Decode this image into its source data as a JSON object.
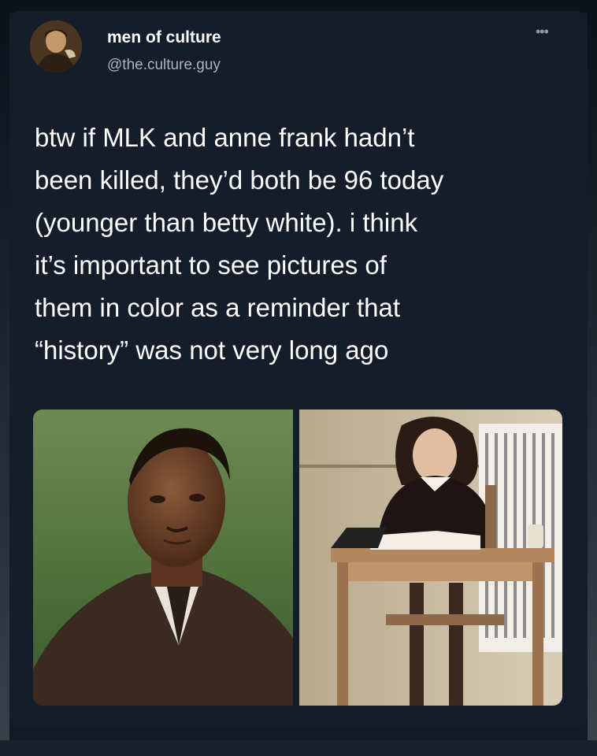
{
  "tweet": {
    "author": {
      "display_name": "men of culture",
      "handle": "@the.culture.guy"
    },
    "more_label": "•••",
    "text_lines": [
      "btw if MLK and anne frank hadn’t",
      "been killed, they’d both be 96 today",
      "(younger than betty white). i think",
      "it’s important to see pictures of",
      "them in color as a reminder that",
      "“history” was not very long ago"
    ],
    "media": [
      {
        "subject": "mlk-portrait"
      },
      {
        "subject": "anne-frank-at-desk"
      }
    ]
  },
  "colors": {
    "background": "#121a26",
    "text_primary": "#ffffff",
    "text_secondary": "#a9b3c1"
  }
}
